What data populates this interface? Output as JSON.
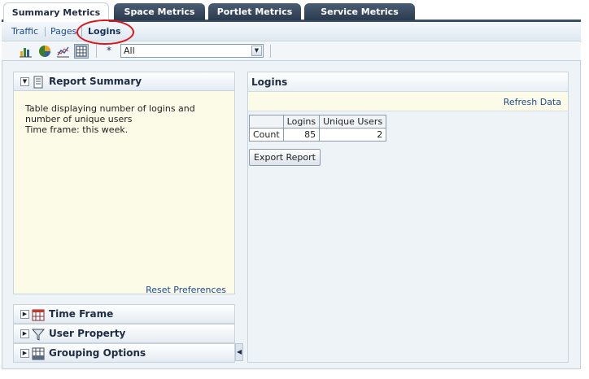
{
  "tabs": [
    {
      "label": "Summary Metrics",
      "active": true
    },
    {
      "label": "Space Metrics",
      "active": false
    },
    {
      "label": "Portlet Metrics",
      "active": false
    },
    {
      "label": "Service Metrics",
      "active": false
    }
  ],
  "subtabs": [
    {
      "label": "Traffic"
    },
    {
      "label": "Pages"
    },
    {
      "label": "Logins",
      "selected": true
    }
  ],
  "toolbar": {
    "icons": [
      "bar-chart-icon",
      "pie-chart-icon",
      "line-chart-icon",
      "table-view-icon"
    ],
    "active_view": "table-view-icon",
    "filter_star": "*",
    "filter_value": "All"
  },
  "left_panel": {
    "report_summary_title": "Report Summary",
    "description_line1": "Table displaying number of logins and number of unique users",
    "description_line2": "Time frame: this week.",
    "reset_label": "Reset Preferences",
    "sections": [
      "Time Frame",
      "User Property",
      "Grouping Options"
    ]
  },
  "right_panel": {
    "title": "Logins",
    "refresh_label": "Refresh Data",
    "table": {
      "headers": [
        "",
        "Logins",
        "Unique Users"
      ],
      "rows": [
        [
          "Count",
          "85",
          "2"
        ]
      ]
    },
    "export_label": "Export Report"
  },
  "colors": {
    "tab_dark": "#2b3a4d",
    "link_blue": "#1d4a8f",
    "highlight_red": "#e0141b",
    "summary_bg": "#fbfbe8"
  }
}
